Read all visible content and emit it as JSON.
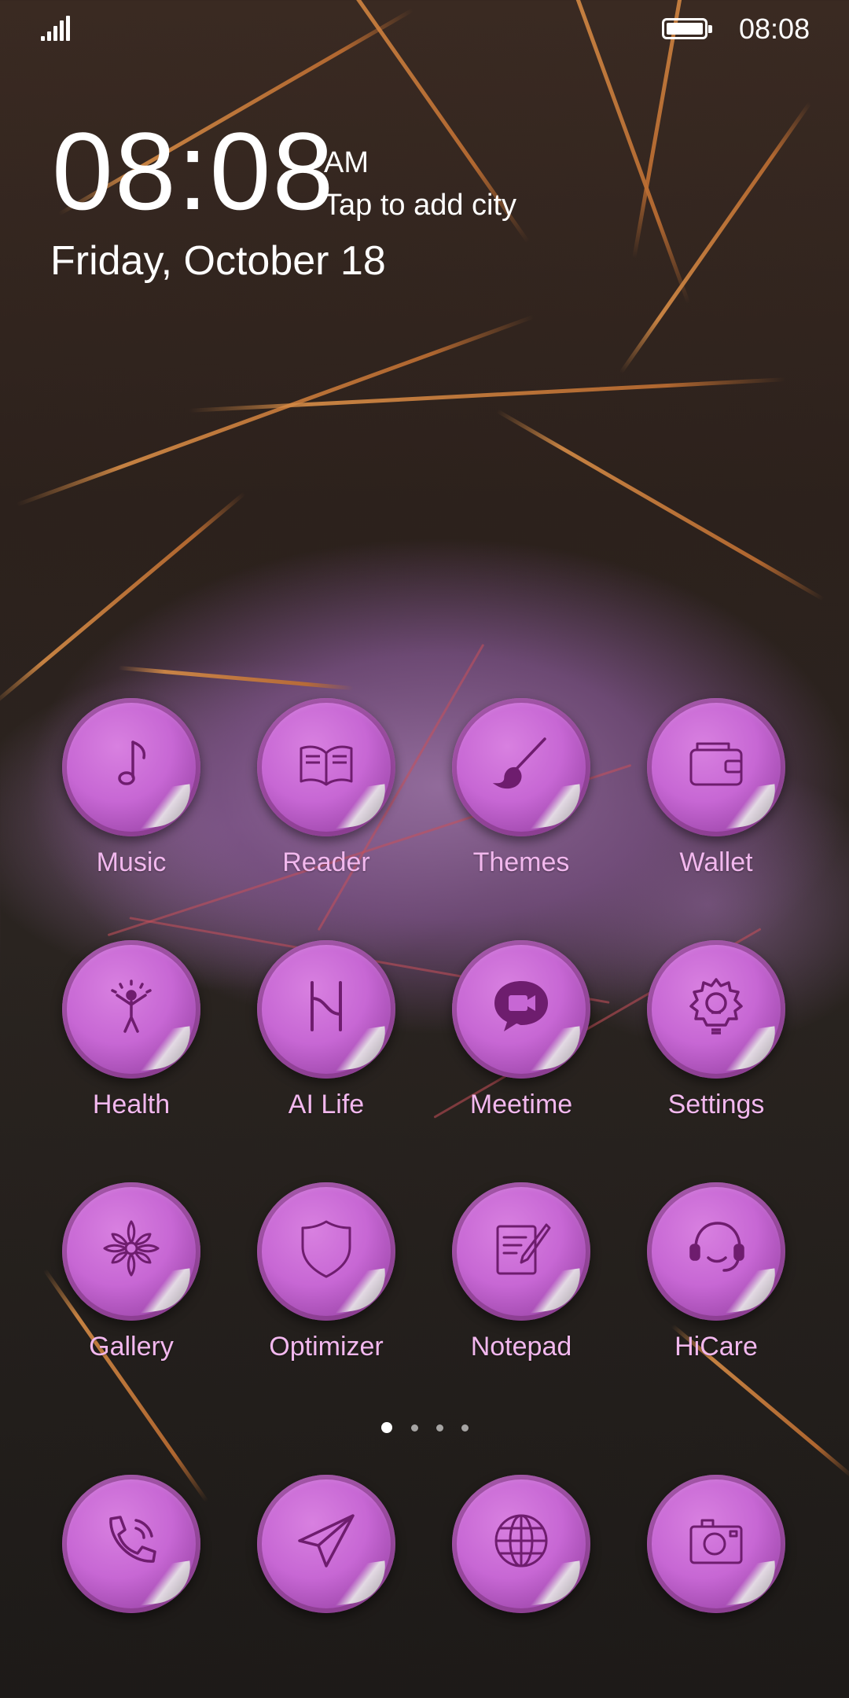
{
  "status_bar": {
    "time": "08:08"
  },
  "clock_widget": {
    "time": "08:08",
    "ampm": "AM",
    "city_prompt": "Tap to add city",
    "date": "Friday, October 18"
  },
  "apps": [
    {
      "label": "Music",
      "icon": "music-note-icon"
    },
    {
      "label": "Reader",
      "icon": "book-icon"
    },
    {
      "label": "Themes",
      "icon": "paintbrush-icon"
    },
    {
      "label": "Wallet",
      "icon": "wallet-icon"
    },
    {
      "label": "Health",
      "icon": "health-person-icon"
    },
    {
      "label": "AI Life",
      "icon": "ai-life-icon"
    },
    {
      "label": "Meetime",
      "icon": "video-chat-icon"
    },
    {
      "label": "Settings",
      "icon": "gear-bulb-icon"
    },
    {
      "label": "Gallery",
      "icon": "flower-icon"
    },
    {
      "label": "Optimizer",
      "icon": "shield-icon"
    },
    {
      "label": "Notepad",
      "icon": "notepad-icon"
    },
    {
      "label": "HiCare",
      "icon": "headset-icon"
    }
  ],
  "page_indicator": {
    "pages": 4,
    "current": 1
  },
  "dock": [
    {
      "icon": "phone-icon"
    },
    {
      "icon": "paper-plane-icon"
    },
    {
      "icon": "globe-icon"
    },
    {
      "icon": "camera-icon"
    }
  ],
  "colors": {
    "icon_bubble": "#c767d4",
    "icon_glyph": "#6e1d6e",
    "label": "#f2b8ee"
  }
}
